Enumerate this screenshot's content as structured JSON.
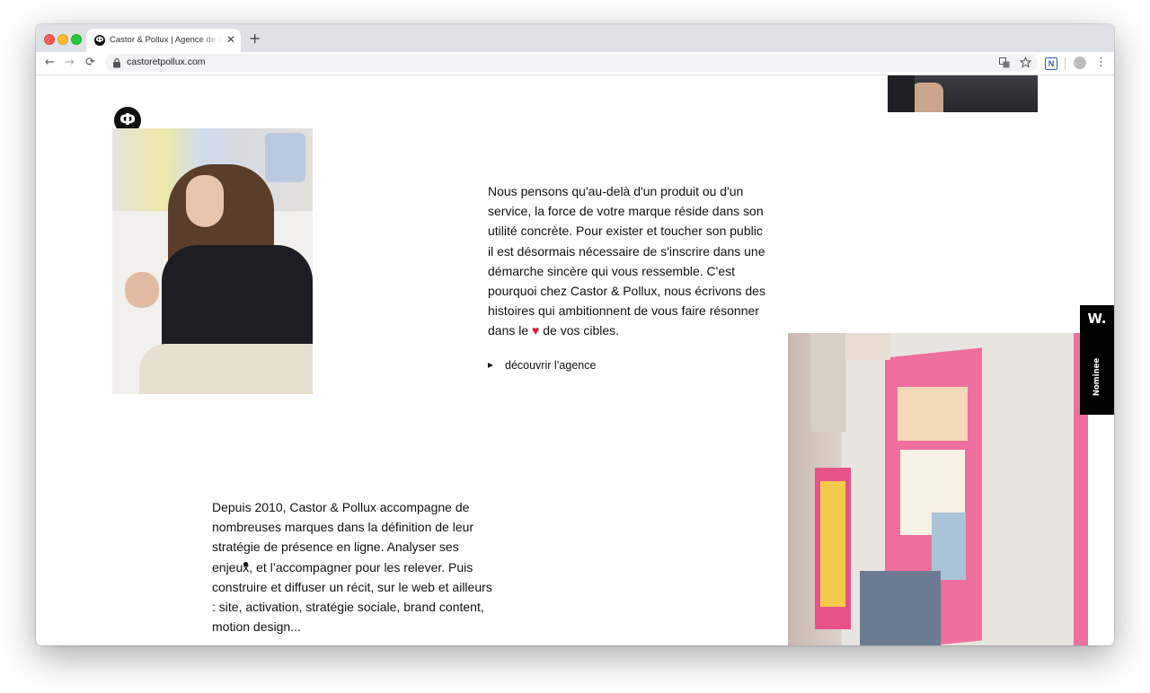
{
  "browser": {
    "tab_title": "Castor & Pollux | Agence de contenu",
    "tab_close": "✕",
    "new_tab": "+",
    "url": "castoretpollux.com",
    "back": "←",
    "forward": "→",
    "reload": "⟳",
    "extension_label": "N"
  },
  "page": {
    "logo_letter": "Ф",
    "intro_text": "Nous pensons qu'au-delà d'un produit ou d'un service, la force de votre marque réside dans son utilité concrète. Pour exister et toucher son public il est désormais nécessaire de s'inscrire dans une démarche sincère qui vous ressemble. C'est pourquoi chez Castor & Pollux, nous écrivons des histoires qui ambitionnent de vous faire résonner dans le",
    "heart": "♥",
    "intro_text_end": "de vos cibles.",
    "cta_label": "découvrir l’agence",
    "history_text": "Depuis 2010, Castor & Pollux accompagne de nombreuses marques dans la définition de leur stratégie de présence en ligne. Analyser ses enjeux, et l’accompagner pour les relever. Puis construire et diffuser un récit, sur le web et ailleurs : site, activation, stratégie sociale, brand content, motion design..."
  },
  "award": {
    "logo": "W.",
    "label": "Nominee"
  },
  "colors": {
    "accent_heart": "#e0182d",
    "text": "#111111",
    "award_bg": "#000000"
  },
  "icons": [
    "back-arrow-icon",
    "forward-arrow-icon",
    "reload-icon",
    "lock-icon",
    "translate-icon",
    "star-icon",
    "profile-icon",
    "kebab-menu-icon"
  ]
}
